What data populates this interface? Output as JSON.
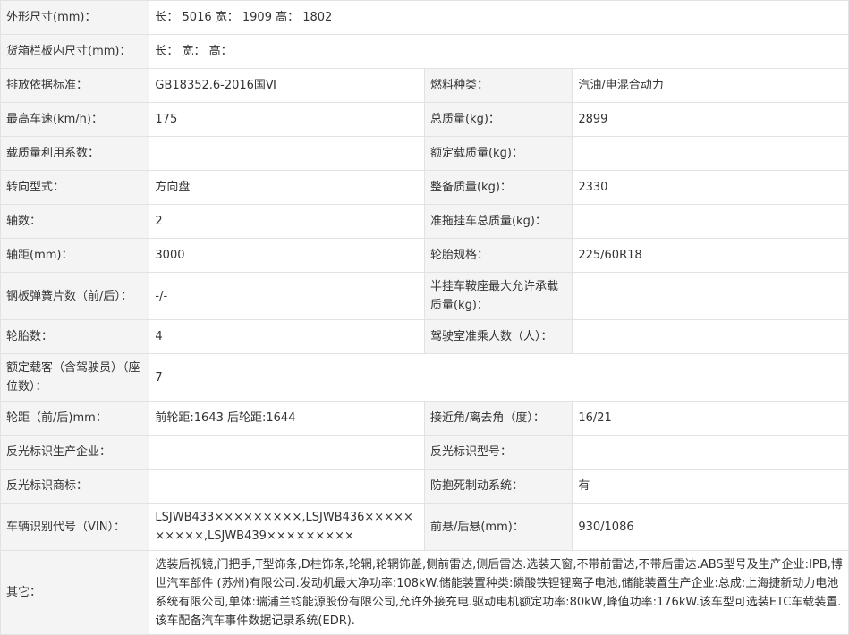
{
  "rows": {
    "dims": {
      "label": "外形尺寸(mm)：",
      "value": "长：  5016  宽：  1909  高：  1802"
    },
    "cargo": {
      "label": "货箱栏板内尺寸(mm)：",
      "value": "长：   宽：   高："
    },
    "emission": {
      "label": "排放依据标准：",
      "value": "GB18352.6-2016国Ⅵ",
      "label2": "燃料种类：",
      "value2": "汽油/电混合动力"
    },
    "speed": {
      "label": "最高车速(km/h)：",
      "value": "175",
      "label2": "总质量(kg)：",
      "value2": "2899"
    },
    "loadcoef": {
      "label": "载质量利用系数：",
      "value": "",
      "label2": "额定载质量(kg)：",
      "value2": ""
    },
    "steering": {
      "label": "转向型式：",
      "value": "方向盘",
      "label2": "整备质量(kg)：",
      "value2": "2330"
    },
    "axles": {
      "label": "轴数：",
      "value": "2",
      "label2": "准拖挂车总质量(kg)：",
      "value2": ""
    },
    "wheelbase": {
      "label": "轴距(mm)：",
      "value": "3000",
      "label2": "轮胎规格：",
      "value2": "225/60R18"
    },
    "spring": {
      "label": "钢板弹簧片数（前/后）：",
      "value": "-/-",
      "label2": "半挂车鞍座最大允许承载质量(kg)：",
      "value2": ""
    },
    "tires": {
      "label": "轮胎数：",
      "value": "4",
      "label2": "驾驶室准乘人数（人）：",
      "value2": ""
    },
    "seats": {
      "label": "额定载客（含驾驶员）（座位数）：",
      "value": "7"
    },
    "track": {
      "label": "轮距（前/后)mm：",
      "value": "前轮距:1643 后轮距:1644",
      "label2": "接近角/离去角（度）：",
      "value2": "16/21"
    },
    "reflector_maker": {
      "label": "反光标识生产企业：",
      "value": "",
      "label2": "反光标识型号：",
      "value2": ""
    },
    "reflector_brand": {
      "label": "反光标识商标：",
      "value": "",
      "label2": "防抱死制动系统：",
      "value2": "有"
    },
    "vin": {
      "label": "车辆识别代号（VIN）：",
      "value": "LSJWB433×××××××××,LSJWB436××××××××××,LSJWB439×××××××××",
      "label2": "前悬/后悬(mm)：",
      "value2": "930/1086"
    },
    "other": {
      "label": "其它：",
      "value": "选装后视镜,门把手,T型饰条,D柱饰条,轮辋,轮辋饰盖,侧前雷达,侧后雷达.选装天窗,不带前雷达,不带后雷达.ABS型号及生产企业:IPB,博世汽车部件 (苏州)有限公司.发动机最大净功率:108kW.储能装置种类:磷酸铁锂锂离子电池,储能装置生产企业:总成:上海捷新动力电池系统有限公司,单体:瑞浦兰钧能源股份有限公司,允许外接充电.驱动电机额定功率:80kW,峰值功率:176kW.该车型可选装ETC车载装置.该车配备汽车事件数据记录系统(EDR)."
    }
  }
}
